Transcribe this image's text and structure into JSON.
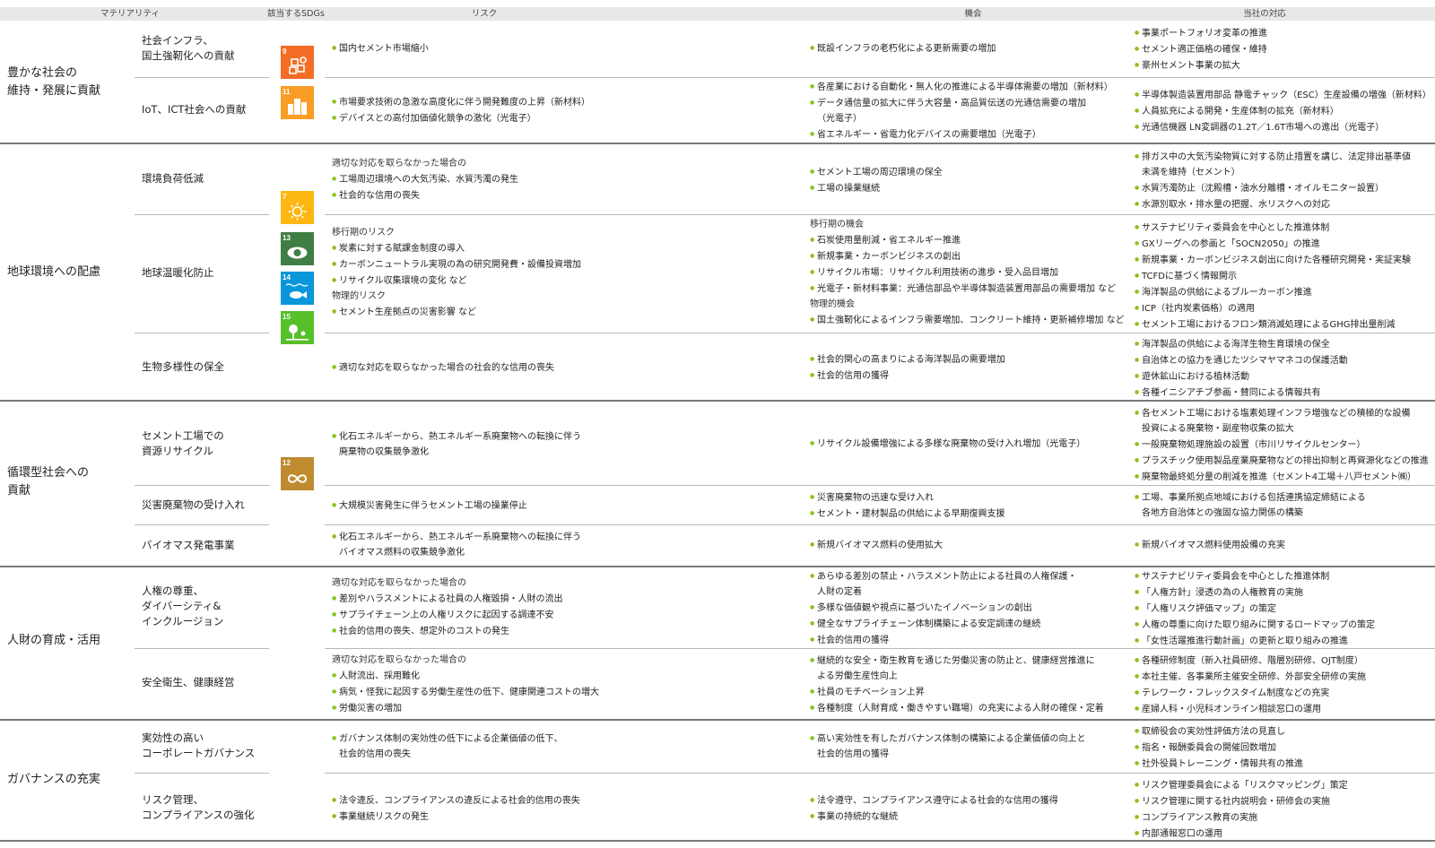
{
  "header": {
    "materiality": "マテリアリティ",
    "sdgs": "該当するSDGs",
    "risk": "リスク",
    "opportunity": "機会",
    "response": "当社の対応"
  },
  "sdg_icons": [
    {
      "number": "9",
      "color": "#f36d25",
      "icon": "industry-innovation-icon"
    },
    {
      "number": "11",
      "color": "#f99d26",
      "icon": "sustainable-cities-icon"
    },
    {
      "number": "7",
      "color": "#fdb713",
      "icon": "clean-energy-icon"
    },
    {
      "number": "13",
      "color": "#3f7e44",
      "icon": "climate-action-icon"
    },
    {
      "number": "14",
      "color": "#0a97d9",
      "icon": "life-below-water-icon"
    },
    {
      "number": "15",
      "color": "#56c02b",
      "icon": "life-on-land-icon"
    },
    {
      "number": "12",
      "color": "#bf8b2e",
      "icon": "responsible-consumption-icon"
    }
  ],
  "materialities": [
    {
      "title": [
        "豊かな社会の",
        "維持・発展に貢献"
      ],
      "subs": [
        {
          "name": [
            "社会インフラ、",
            "国土強靭化への貢献"
          ],
          "risk": [
            {
              "t": "国内セメント市場縮小",
              "k": "b"
            }
          ],
          "opportunity": [
            {
              "t": "既設インフラの老朽化による更新需要の増加",
              "k": "b"
            }
          ],
          "response": [
            {
              "t": "事業ポートフォリオ変革の推進",
              "k": "b"
            },
            {
              "t": "セメント適正価格の確保・維持",
              "k": "b"
            },
            {
              "t": "豪州セメント事業の拡大",
              "k": "b"
            }
          ]
        },
        {
          "name": [
            "IoT、ICT社会への貢献"
          ],
          "risk": [
            {
              "t": "市場要求技術の急激な高度化に伴う開発難度の上昇（新材料）",
              "k": "b"
            },
            {
              "t": "デバイスとの高付加価値化競争の激化（光電子）",
              "k": "b"
            }
          ],
          "opportunity": [
            {
              "t": "各産業における自動化・無人化の推進による半導体需要の増加（新材料）",
              "k": "b"
            },
            {
              "t": "データ通信量の拡大に伴う大容量・高品質伝送の光通信需要の増加",
              "k": "b"
            },
            {
              "t": "（光電子）",
              "k": "c"
            },
            {
              "t": "省エネルギー・省電力化デバイスの需要増加（光電子）",
              "k": "b"
            }
          ],
          "response": [
            {
              "t": "半導体製造装置用部品 静電チャック（ESC）生産設備の増強（新材料）",
              "k": "b"
            },
            {
              "t": "人員拡充による開発・生産体制の拡充（新材料）",
              "k": "b"
            },
            {
              "t": "光通信機器 LN変調器の1.2T／1.6T市場への進出（光電子）",
              "k": "b"
            }
          ]
        }
      ]
    },
    {
      "title": [
        "地球環境への配慮"
      ],
      "subs": [
        {
          "name": [
            "環境負荷低減"
          ],
          "risk": [
            {
              "t": "適切な対応を取らなかった場合の",
              "k": "h"
            },
            {
              "t": "工場周辺環境への大気汚染、水質汚濁の発生",
              "k": "b"
            },
            {
              "t": "社会的な信用の喪失",
              "k": "b"
            }
          ],
          "opportunity": [
            {
              "t": "セメント工場の周辺環境の保全",
              "k": "b"
            },
            {
              "t": "工場の操業継続",
              "k": "b"
            }
          ],
          "response": [
            {
              "t": "排ガス中の大気汚染物質に対する防止措置を講じ、法定排出基準値",
              "k": "b"
            },
            {
              "t": "未満を維持（セメント）",
              "k": "c"
            },
            {
              "t": "水質汚濁防止（沈殿槽・油水分離槽・オイルモニター設置）",
              "k": "b"
            },
            {
              "t": "水源別取水・排水量の把握、水リスクへの対応",
              "k": "b"
            }
          ]
        },
        {
          "name": [
            "地球温暖化防止"
          ],
          "risk": [
            {
              "t": "移行期のリスク",
              "k": "h"
            },
            {
              "t": "炭素に対する賦課金制度の導入",
              "k": "b"
            },
            {
              "t": "カーボンニュートラル実現の為の研究開発費・設備投資増加",
              "k": "b"
            },
            {
              "t": "リサイクル収集環境の変化 など",
              "k": "b"
            },
            {
              "t": "物理的リスク",
              "k": "h"
            },
            {
              "t": "セメント生産拠点の災害影響 など",
              "k": "b"
            }
          ],
          "opportunity": [
            {
              "t": "移行期の機会",
              "k": "h"
            },
            {
              "t": "石炭使用量削減・省エネルギー推進",
              "k": "b"
            },
            {
              "t": "新規事業・カーボンビジネスの創出",
              "k": "b"
            },
            {
              "t": "リサイクル市場：リサイクル利用技術の進歩・受入品目増加",
              "k": "b"
            },
            {
              "t": "光電子・新材料事業：光通信部品や半導体製造装置用部品の需要増加 など",
              "k": "b"
            },
            {
              "t": "物理的機会",
              "k": "h"
            },
            {
              "t": "国土強靭化によるインフラ需要増加、コンクリート維持・更新補修増加 など",
              "k": "b"
            }
          ],
          "response": [
            {
              "t": "サステナビリティ委員会を中心とした推進体制",
              "k": "b"
            },
            {
              "t": "GXリーグへの参画と「SOCN2050」の推進",
              "k": "b"
            },
            {
              "t": "新規事業・カーボンビジネス創出に向けた各種研究開発・実証実験",
              "k": "b"
            },
            {
              "t": "TCFDに基づく情報開示",
              "k": "b"
            },
            {
              "t": "海洋製品の供給によるブルーカーボン推進",
              "k": "b"
            },
            {
              "t": "ICP（社内炭素価格）の適用",
              "k": "b"
            },
            {
              "t": "セメント工場におけるフロン類消滅処理によるGHG排出量削減",
              "k": "b"
            }
          ]
        },
        {
          "name": [
            "生物多様性の保全"
          ],
          "risk": [
            {
              "t": "適切な対応を取らなかった場合の社会的な信用の喪失",
              "k": "b"
            }
          ],
          "opportunity": [
            {
              "t": "社会的関心の高まりによる海洋製品の需要増加",
              "k": "b"
            },
            {
              "t": "社会的信用の獲得",
              "k": "b"
            }
          ],
          "response": [
            {
              "t": "海洋製品の供給による海洋生物生育環境の保全",
              "k": "b"
            },
            {
              "t": "自治体との協力を通じたツシマヤマネコの保護活動",
              "k": "b"
            },
            {
              "t": "遊休鉱山における植林活動",
              "k": "b"
            },
            {
              "t": "各種イニシアチブ参画・賛同による情報共有",
              "k": "b"
            }
          ]
        }
      ]
    },
    {
      "title": [
        "循環型社会への",
        "貢献"
      ],
      "subs": [
        {
          "name": [
            "セメント工場での",
            "資源リサイクル"
          ],
          "risk": [
            {
              "t": "化石エネルギーから、熱エネルギー系廃棄物への転換に伴う",
              "k": "b"
            },
            {
              "t": "廃棄物の収集競争激化",
              "k": "c"
            }
          ],
          "opportunity": [
            {
              "t": "リサイクル設備増強による多様な廃棄物の受け入れ増加（光電子）",
              "k": "b"
            }
          ],
          "response": [
            {
              "t": "各セメント工場における塩素処理インフラ増強などの積極的な設備",
              "k": "b"
            },
            {
              "t": "投資による廃棄物・副産物収集の拡大",
              "k": "c"
            },
            {
              "t": "一般廃棄物処理施設の設置（市川リサイクルセンター）",
              "k": "b"
            },
            {
              "t": "プラスチック使用製品産業廃棄物などの排出抑制と再資源化などの推進",
              "k": "b"
            },
            {
              "t": "廃棄物最終処分量の削減を推進（セメント4工場＋八戸セメント㈱）",
              "k": "b"
            }
          ]
        },
        {
          "name": [
            "災害廃棄物の受け入れ"
          ],
          "risk": [
            {
              "t": "大規模災害発生に伴うセメント工場の操業停止",
              "k": "b"
            }
          ],
          "opportunity": [
            {
              "t": "災害廃棄物の迅速な受け入れ",
              "k": "b"
            },
            {
              "t": "セメント・建材製品の供給による早期復興支援",
              "k": "b"
            }
          ],
          "response": [
            {
              "t": "工場、事業所拠点地域における包括連携協定締結による",
              "k": "b"
            },
            {
              "t": "各地方自治体との強固な協力関係の構築",
              "k": "c"
            }
          ]
        },
        {
          "name": [
            "バイオマス発電事業"
          ],
          "risk": [
            {
              "t": "化石エネルギーから、熱エネルギー系廃棄物への転換に伴う",
              "k": "b"
            },
            {
              "t": "バイオマス燃料の収集競争激化",
              "k": "c"
            }
          ],
          "opportunity": [
            {
              "t": "新規バイオマス燃料の使用拡大",
              "k": "b"
            }
          ],
          "response": [
            {
              "t": "新規バイオマス燃料使用設備の充実",
              "k": "b"
            }
          ]
        }
      ]
    },
    {
      "title": [
        "人財の育成・活用"
      ],
      "subs": [
        {
          "name": [
            "人権の尊重、",
            "ダイバーシティ&",
            "インクルージョン"
          ],
          "risk": [
            {
              "t": "適切な対応を取らなかった場合の",
              "k": "h"
            },
            {
              "t": "差別やハラスメントによる社員の人権毀損・人財の流出",
              "k": "b"
            },
            {
              "t": "サプライチェーン上の人権リスクに起因する調達不安",
              "k": "b"
            },
            {
              "t": "社会的信用の喪失、想定外のコストの発生",
              "k": "b"
            }
          ],
          "opportunity": [
            {
              "t": "あらゆる差別の禁止・ハラスメント防止による社員の人権保護・",
              "k": "b"
            },
            {
              "t": "人財の定着",
              "k": "c"
            },
            {
              "t": "多様な価値観や視点に基づいたイノベーションの創出",
              "k": "b"
            },
            {
              "t": "健全なサプライチェーン体制構築による安定調達の継続",
              "k": "b"
            },
            {
              "t": "社会的信用の獲得",
              "k": "b"
            }
          ],
          "response": [
            {
              "t": "サステナビリティ委員会を中心とした推進体制",
              "k": "b"
            },
            {
              "t": "「人権方針」浸透の為の人権教育の実施",
              "k": "b"
            },
            {
              "t": "「人権リスク評価マップ」の策定",
              "k": "b"
            },
            {
              "t": "人権の尊重に向けた取り組みに関するロードマップの策定",
              "k": "b"
            },
            {
              "t": "「女性活躍推進行動計画」の更新と取り組みの推進",
              "k": "b"
            }
          ]
        },
        {
          "name": [
            "安全衛生、健康経営"
          ],
          "risk": [
            {
              "t": "適切な対応を取らなかった場合の",
              "k": "h"
            },
            {
              "t": "人財流出、採用難化",
              "k": "b"
            },
            {
              "t": "病気・怪我に起因する労働生産性の低下、健康関連コストの増大",
              "k": "b"
            },
            {
              "t": "労働災害の増加",
              "k": "b"
            }
          ],
          "opportunity": [
            {
              "t": "継続的な安全・衛生教育を通じた労働災害の防止と、健康経営推進に",
              "k": "b"
            },
            {
              "t": "よる労働生産性向上",
              "k": "c"
            },
            {
              "t": "社員のモチベーション上昇",
              "k": "b"
            },
            {
              "t": "各種制度（人財育成・働きやすい職場）の充実による人財の確保・定着",
              "k": "b"
            }
          ],
          "response": [
            {
              "t": "各種研修制度（新入社員研修、階層別研修、OJT制度）",
              "k": "b"
            },
            {
              "t": "本社主催、各事業所主催安全研修、外部安全研修の実施",
              "k": "b"
            },
            {
              "t": "テレワーク・フレックスタイム制度などの充実",
              "k": "b"
            },
            {
              "t": "産婦人科・小児科オンライン相談窓口の運用",
              "k": "b"
            }
          ]
        }
      ]
    },
    {
      "title": [
        "ガバナンスの充実"
      ],
      "subs": [
        {
          "name": [
            "実効性の高い",
            "コーポレートガバナンス"
          ],
          "risk": [
            {
              "t": "ガバナンス体制の実効性の低下による企業価値の低下、",
              "k": "b"
            },
            {
              "t": "社会的信用の喪失",
              "k": "c"
            }
          ],
          "opportunity": [
            {
              "t": "高い実効性を有したガバナンス体制の構築による企業価値の向上と",
              "k": "b"
            },
            {
              "t": "社会的信用の獲得",
              "k": "c"
            }
          ],
          "response": [
            {
              "t": "取締役会の実効性評価方法の見直し",
              "k": "b"
            },
            {
              "t": "指名・報酬委員会の開催回数増加",
              "k": "b"
            },
            {
              "t": "社外役員トレーニング・情報共有の推進",
              "k": "b"
            }
          ]
        },
        {
          "name": [
            "リスク管理、",
            "コンプライアンスの強化"
          ],
          "risk": [
            {
              "t": "法令違反、コンプライアンスの違反による社会的信用の喪失",
              "k": "b"
            },
            {
              "t": "事業継続リスクの発生",
              "k": "b"
            }
          ],
          "opportunity": [
            {
              "t": "法令遵守、コンプライアンス遵守による社会的な信用の獲得",
              "k": "b"
            },
            {
              "t": "事業の持続的な継続",
              "k": "b"
            }
          ],
          "response": [
            {
              "t": "リスク管理委員会による「リスクマッピング」策定",
              "k": "b"
            },
            {
              "t": "リスク管理に関する社内説明会・研修会の実施",
              "k": "b"
            },
            {
              "t": "コンプライアンス教育の実施",
              "k": "b"
            },
            {
              "t": "内部通報窓口の運用",
              "k": "b"
            }
          ]
        }
      ]
    }
  ]
}
